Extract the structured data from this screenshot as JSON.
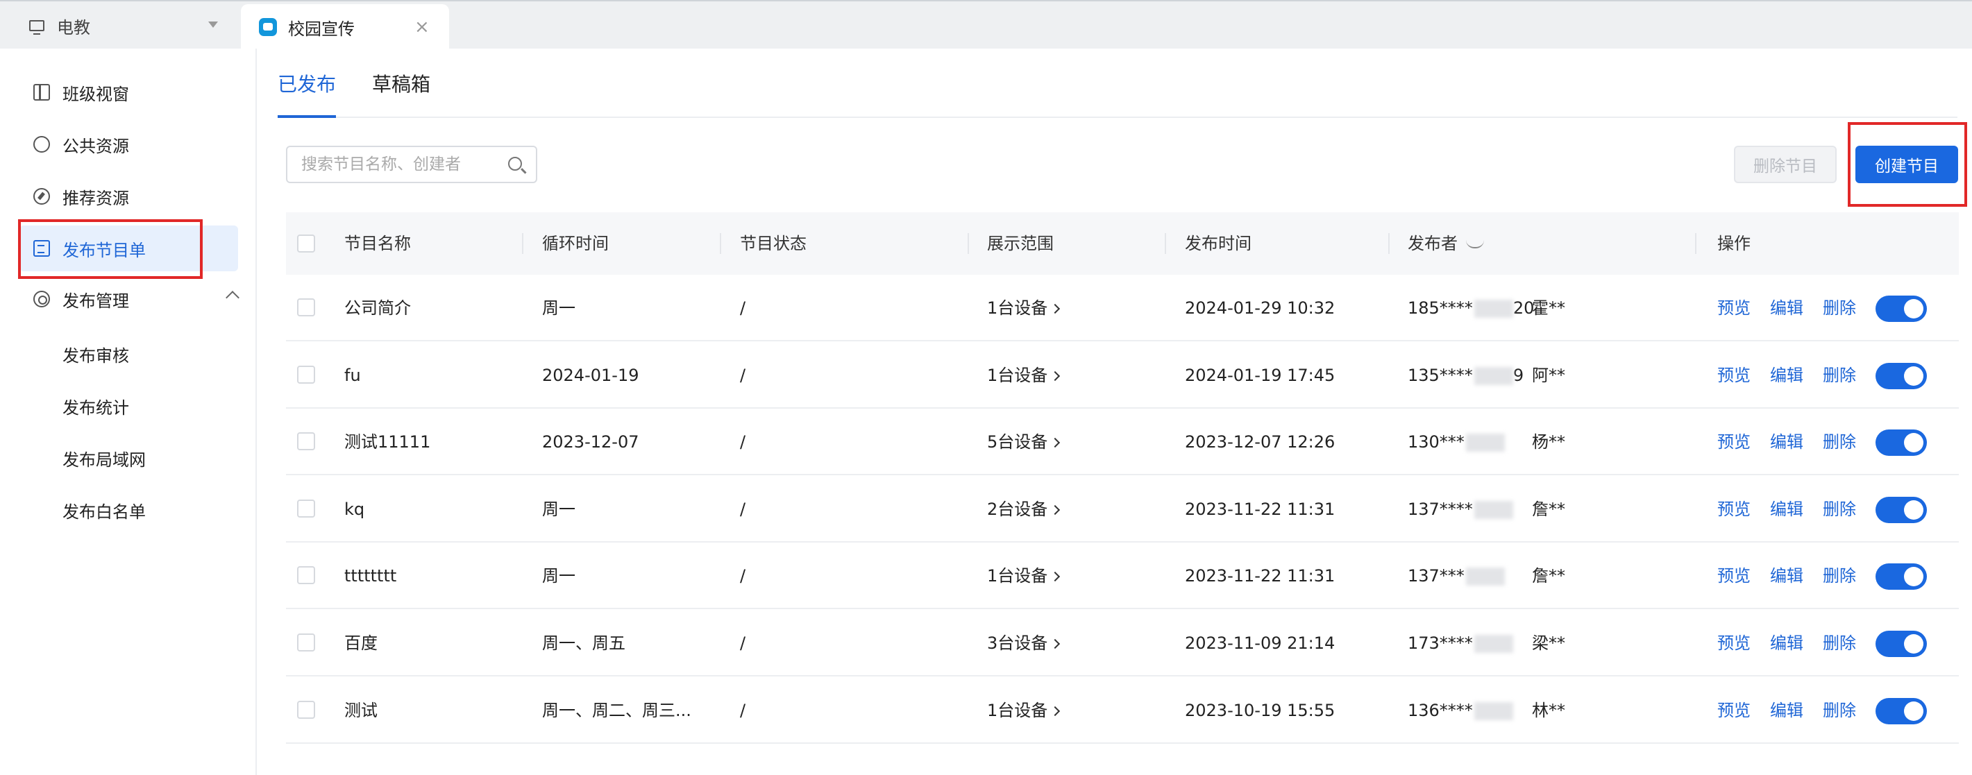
{
  "topbar": {
    "workspace_label": "电教",
    "app_tab_label": "校园宣传",
    "close_glyph": "×"
  },
  "sidebar": {
    "items": [
      {
        "label": "班级视窗",
        "icon": "board-icon"
      },
      {
        "label": "公共资源",
        "icon": "share-icon"
      },
      {
        "label": "推荐资源",
        "icon": "compass-icon"
      },
      {
        "label": "发布节目单",
        "icon": "document-icon",
        "active": true
      },
      {
        "label": "发布管理",
        "icon": "gear-icon",
        "expanded": true
      }
    ],
    "sub_items": [
      "发布审核",
      "发布统计",
      "发布局域网",
      "发布白名单"
    ]
  },
  "main": {
    "tabs": [
      {
        "label": "已发布",
        "active": true
      },
      {
        "label": "草稿箱",
        "active": false
      }
    ],
    "search": {
      "placeholder": "搜索节目名称、创建者",
      "value": ""
    },
    "delete_button": "删除节目",
    "create_button": "创建节目"
  },
  "table": {
    "columns": [
      "节目名称",
      "循环时间",
      "节目状态",
      "展示范围",
      "发布时间",
      "发布者",
      "操作"
    ],
    "rows": [
      {
        "name": "公司简介",
        "cycle": "周一",
        "status": "/",
        "scope": "1台设备",
        "time": "2024-01-29 10:32",
        "phone": "185****",
        "phone_tail": "20",
        "user": "霍**"
      },
      {
        "name": "fu",
        "cycle": "2024-01-19",
        "status": "/",
        "scope": "1台设备",
        "time": "2024-01-19 17:45",
        "phone": "135****",
        "phone_tail": "9",
        "user": "阿**"
      },
      {
        "name": "测试11111",
        "cycle": "2023-12-07",
        "status": "/",
        "scope": "5台设备",
        "time": "2023-12-07 12:26",
        "phone": "130***",
        "phone_tail": "",
        "user": "杨**"
      },
      {
        "name": "kq",
        "cycle": "周一",
        "status": "/",
        "scope": "2台设备",
        "time": "2023-11-22 11:31",
        "phone": "137****",
        "phone_tail": "",
        "user": "詹**"
      },
      {
        "name": "tttttttt",
        "cycle": "周一",
        "status": "/",
        "scope": "1台设备",
        "time": "2023-11-22 11:31",
        "phone": "137***",
        "phone_tail": "",
        "user": "詹**"
      },
      {
        "name": "百度",
        "cycle": "周一、周五",
        "status": "/",
        "scope": "3台设备",
        "time": "2023-11-09 21:14",
        "phone": "173****",
        "phone_tail": "",
        "user": "梁**"
      },
      {
        "name": "测试",
        "cycle": "周一、周二、周三...",
        "status": "/",
        "scope": "1台设备",
        "time": "2023-10-19 15:55",
        "phone": "136****",
        "phone_tail": "",
        "user": "林**"
      }
    ],
    "actions": {
      "preview": "预览",
      "edit": "编辑",
      "delete": "删除"
    },
    "toggle_enabled": true
  },
  "colors": {
    "accent": "#1a68e0",
    "highlight": "#e12828"
  }
}
